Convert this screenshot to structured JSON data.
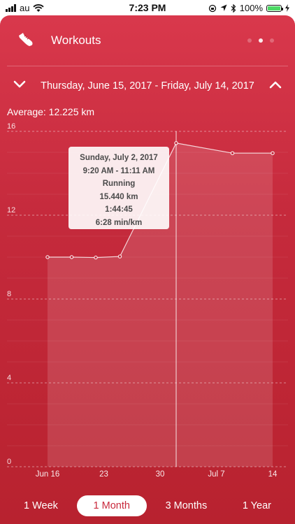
{
  "status_bar": {
    "carrier": "au",
    "time": "7:23 PM",
    "battery": "100%"
  },
  "header": {
    "title": "Workouts",
    "icon": "shoe-icon",
    "page_count": 3,
    "active_page": 2
  },
  "date_range": {
    "label": "Thursday, June 15, 2017 - Friday, July 14, 2017"
  },
  "average": "Average: 12.225 km",
  "tooltip": {
    "lines": [
      "Sunday, July 2, 2017",
      "9:20 AM - 11:11 AM",
      "Running",
      "15.440 km",
      "1:44:45",
      "6:28 min/km"
    ]
  },
  "segments": [
    {
      "label": "1 Week",
      "active": false
    },
    {
      "label": "1 Month",
      "active": true
    },
    {
      "label": "3 Months",
      "active": false
    },
    {
      "label": "1 Year",
      "active": false
    }
  ],
  "colors": {
    "accent": "#c9293c",
    "background_top": "#d9384c",
    "background_bottom": "#b8222f"
  },
  "chart_data": {
    "type": "area",
    "y_ticks": [
      "16",
      "12",
      "8",
      "4",
      "0"
    ],
    "x_ticks": [
      "Jun 16",
      "23",
      "30",
      "Jul 7",
      "14"
    ],
    "ylim": [
      0,
      16
    ],
    "xlim_days": [
      "2017-06-15",
      "2017-07-14"
    ],
    "points": [
      {
        "date": "2017-06-16",
        "km": 10.0
      },
      {
        "date": "2017-06-19",
        "km": 10.0
      },
      {
        "date": "2017-06-22",
        "km": 9.98
      },
      {
        "date": "2017-06-25",
        "km": 10.03
      },
      {
        "date": "2017-07-02",
        "km": 15.44
      },
      {
        "date": "2017-07-09",
        "km": 14.96
      },
      {
        "date": "2017-07-14",
        "km": 14.96
      }
    ],
    "selected_date": "2017-07-02",
    "grid": true
  }
}
